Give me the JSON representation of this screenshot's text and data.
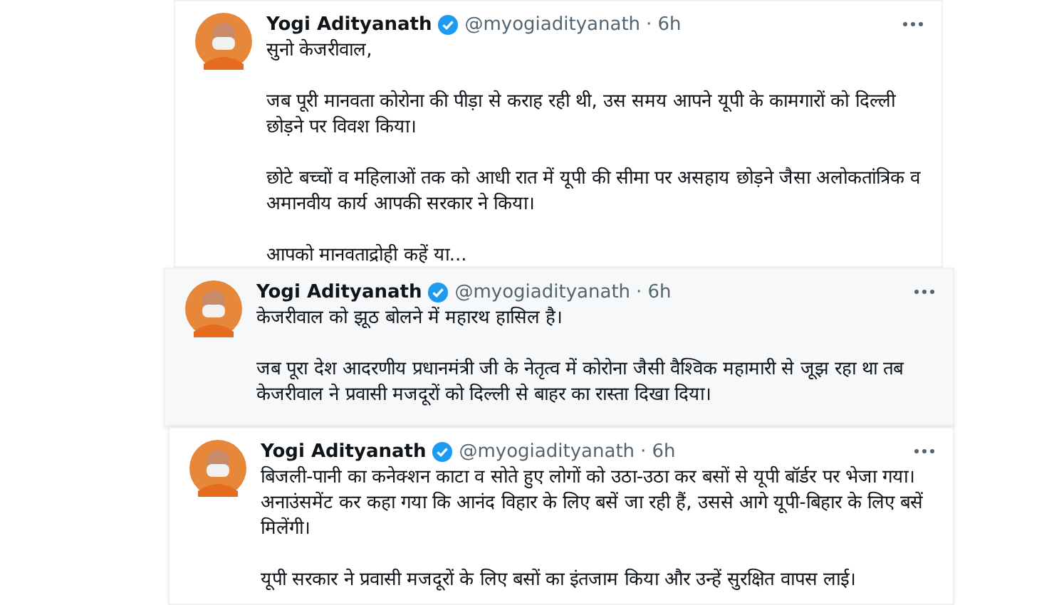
{
  "tweets": [
    {
      "name": "Yogi Adityanath",
      "verified": true,
      "handle": "@myogiadityanath",
      "separator": "·",
      "time": "6h",
      "paragraphs": [
        "सुनो केजरीवाल,",
        "जब पूरी मानवता कोरोना की पीड़ा से कराह रही थी, उस समय आपने यूपी के कामगारों को दिल्ली छोड़ने पर विवश किया।",
        "छोटे बच्चों व महिलाओं तक को आधी रात में यूपी की सीमा पर असहाय छोड़ने जैसा अलोकतांत्रिक व अमानवीय कार्य आपकी सरकार ने किया।",
        "आपको मानवताद्रोही कहें या..."
      ]
    },
    {
      "name": "Yogi Adityanath",
      "verified": true,
      "handle": "@myogiadityanath",
      "separator": "·",
      "time": "6h",
      "paragraphs": [
        "केजरीवाल को झूठ बोलने में महारथ हासिल है।",
        "जब पूरा देश आदरणीय प्रधानमंत्री जी के नेतृत्व में कोरोना जैसी वैश्विक महामारी से जूझ रहा था तब केजरीवाल ने प्रवासी मजदूरों को दिल्ली से बाहर का रास्ता दिखा दिया।"
      ]
    },
    {
      "name": "Yogi Adityanath",
      "verified": true,
      "handle": "@myogiadityanath",
      "separator": "·",
      "time": "6h",
      "paragraphs": [
        "बिजली-पानी का कनेक्शन काटा व सोते हुए लोगों को उठा-उठा कर बसों से यूपी बॉर्डर पर भेजा गया। अनाउंसमेंट कर कहा गया कि आनंद विहार के लिए बसें जा रही हैं, उससे आगे यूपी-बिहार के लिए बसें मिलेंगी।",
        "यूपी सरकार ने प्रवासी मजदूरों के लिए बसों का इंतजाम किया और उन्हें सुरक्षित वापस लाई।"
      ]
    }
  ]
}
